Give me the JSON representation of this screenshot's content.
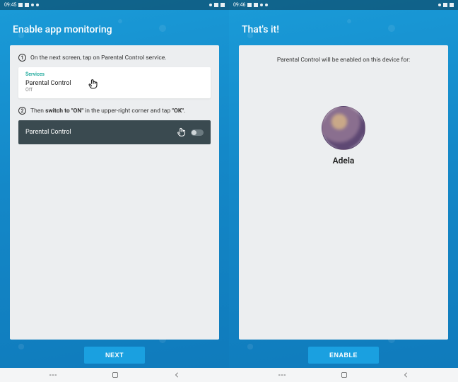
{
  "left": {
    "status_time": "09:45",
    "title": "Enable app monitoring",
    "step1_num": "1",
    "step1_text": "On the next screen, tap on Parental Control service.",
    "services_label": "Services",
    "service_name": "Parental Control",
    "service_state": "Off",
    "step2_num": "2",
    "step2_prefix": "Then ",
    "step2_bold": "switch to \"ON\"",
    "step2_mid": " in the upper-right corner and tap ",
    "step2_ok": "\"OK\"",
    "step2_suffix": ".",
    "toggle_label": "Parental Control",
    "button": "NEXT"
  },
  "right": {
    "status_time": "09:46",
    "title": "That's it!",
    "info": "Parental Control will be enabled on this device for:",
    "profile_name": "Adela",
    "button": "ENABLE"
  }
}
